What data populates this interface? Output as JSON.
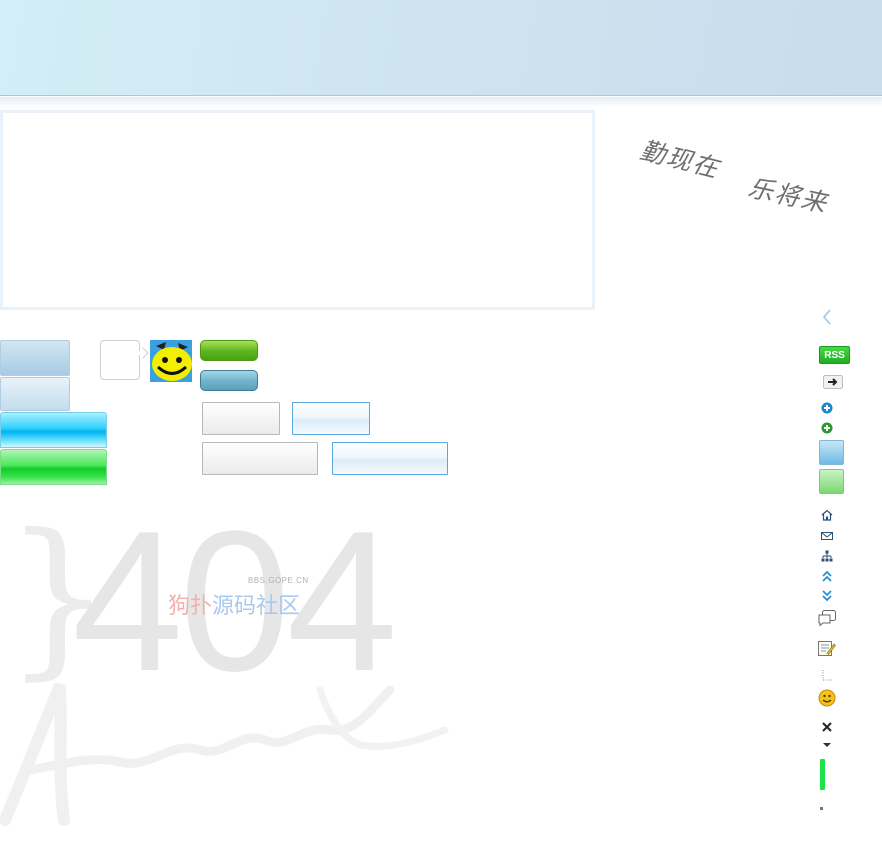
{
  "slogan": {
    "part1": "勤现在",
    "part2": "乐将来"
  },
  "error": {
    "code": "404"
  },
  "watermark": {
    "domain": "BBS.GOPE.CN",
    "name_red": "狗扑",
    "name_blue": "源码社区"
  },
  "sidebar": {
    "rss_label": "RSS",
    "icons": [
      "back-chevron-icon",
      "rss-badge",
      "arrow-right-icon",
      "add-blue-icon",
      "add-green-icon",
      "blue-tile-icon",
      "green-tile-icon",
      "home-icon",
      "mail-icon",
      "sitemap-icon",
      "double-up-icon",
      "double-down-icon",
      "comments-icon",
      "edit-note-icon",
      "dotted-corner-icon",
      "smiley-icon",
      "close-icon",
      "dropdown-arrow-icon",
      "progress-bar-icon",
      "dot-icon"
    ]
  },
  "colors": {
    "banner": "#cfe6f1",
    "accent_blue": "#5aa7e0",
    "accent_green": "#1eae1f"
  }
}
